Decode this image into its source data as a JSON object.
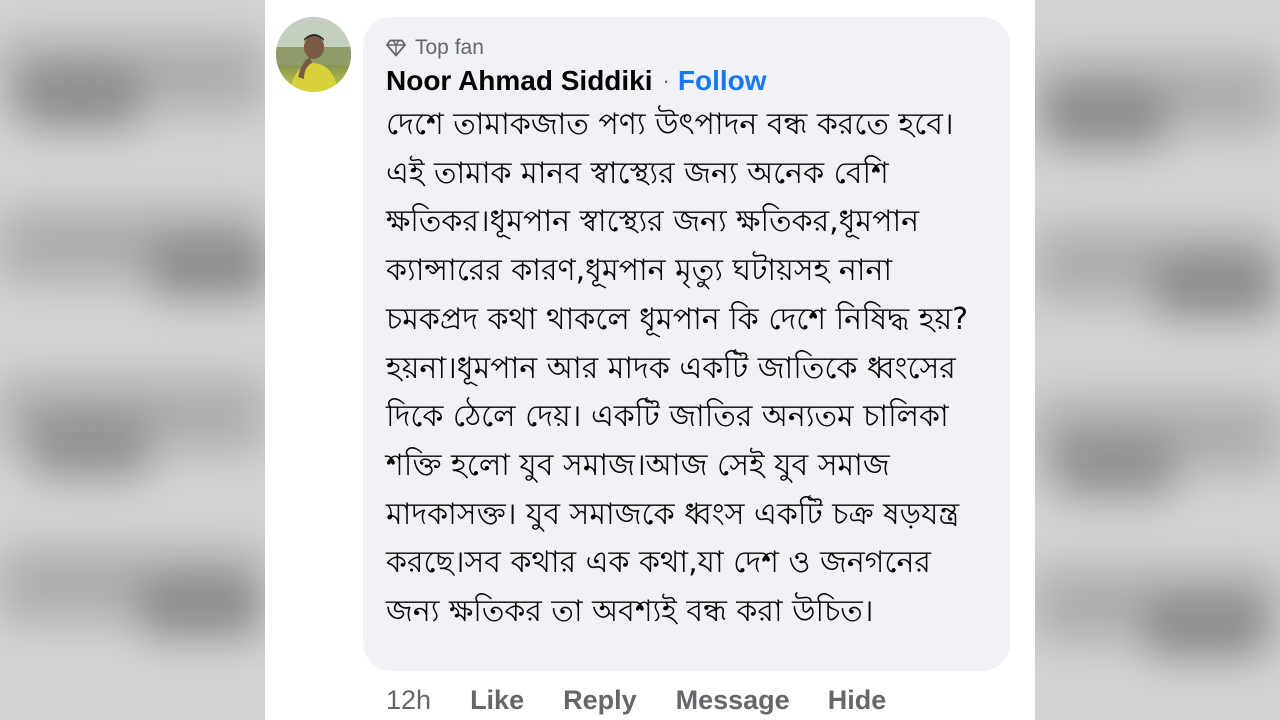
{
  "comment": {
    "badge_icon": "diamond-icon",
    "badge_label": "Top fan",
    "author_name": "Noor Ahmad Siddiki",
    "separator": "·",
    "follow_label": "Follow",
    "text": "দেশে তামাকজাত পণ্য উৎপাদন বন্ধ করতে হবে।এই তামাক মানব স্বাস্থ্যের জন্য অনেক বেশি ক্ষতিকর।ধূমপান স্বাস্থ্যের জন্য ক্ষতিকর,ধূমপান ক্যান্সারের কারণ,ধূমপান মৃত্যু ঘটায়সহ নানা চমকপ্রদ কথা থাকলে ধূমপান কি দেশে নিষিদ্ধ হয়? হয়না।ধূমপান আর মাদক একটি জাতিকে ধ্বংসের দিকে ঠেলে দেয়। একটি জাতির অন্যতম চালিকা শক্তি হলো যুব সমাজ।আজ সেই যুব সমাজ মাদকাসক্ত। যুব সমাজকে ধ্বংস একটি চক্র ষড়যন্ত্র করছে।সব কথার এক কথা,যা দেশ ও জনগনের জন্য ক্ষতিকর তা অবশ্যই বন্ধ করা উচিত।"
  },
  "actions": {
    "time": "12h",
    "like_label": "Like",
    "reply_label": "Reply",
    "message_label": "Message",
    "hide_label": "Hide"
  },
  "colors": {
    "link_blue": "#1877f2",
    "bubble_bg": "#f0f2f5",
    "secondary_text": "#65676b",
    "primary_text": "#050505"
  }
}
